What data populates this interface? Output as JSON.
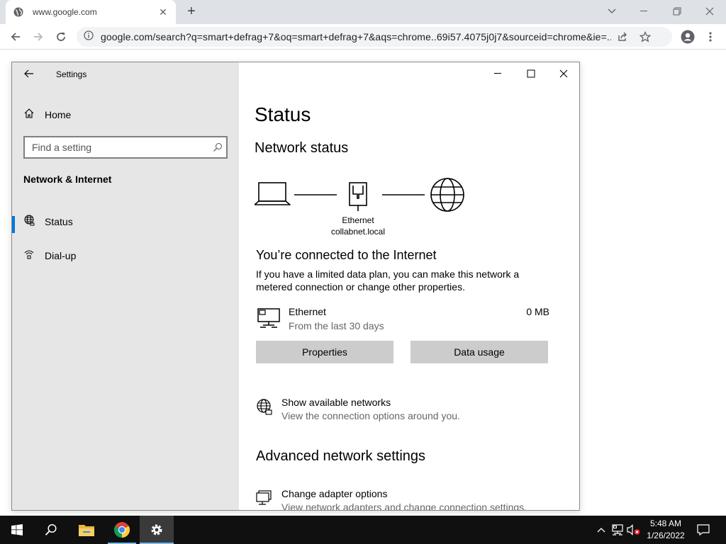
{
  "browser": {
    "tab_title": "www.google.com",
    "url": "google.com/search?q=smart+defrag+7&oq=smart+defrag+7&aqs=chrome..69i57.4075j0j7&sourceid=chrome&ie=..."
  },
  "settings": {
    "window_title": "Settings",
    "sidebar": {
      "home_label": "Home",
      "search_placeholder": "Find a setting",
      "section_title": "Network & Internet",
      "items": [
        {
          "label": "Status",
          "icon": "globe-icon",
          "active": true
        },
        {
          "label": "Dial-up",
          "icon": "dialup-icon",
          "active": false
        }
      ]
    },
    "content": {
      "page_title": "Status",
      "network_status_heading": "Network status",
      "diagram": {
        "adapter_name": "Ethernet",
        "network_name": "collabnet.local"
      },
      "connected_heading": "You’re connected to the Internet",
      "connected_desc": "If you have a limited data plan, you can make this network a metered connection or change other properties.",
      "ethernet": {
        "name": "Ethernet",
        "subtitle": "From the last 30 days",
        "usage": "0 MB"
      },
      "buttons": {
        "properties": "Properties",
        "data_usage": "Data usage"
      },
      "show_networks": {
        "title": "Show available networks",
        "subtitle": "View the connection options around you."
      },
      "advanced_heading": "Advanced network settings",
      "change_adapter": {
        "title": "Change adapter options",
        "subtitle": "View network adapters and change connection settings."
      }
    }
  },
  "taskbar": {
    "time": "5:48 AM",
    "date": "1/26/2022",
    "accent_color": "#76b9ed"
  }
}
